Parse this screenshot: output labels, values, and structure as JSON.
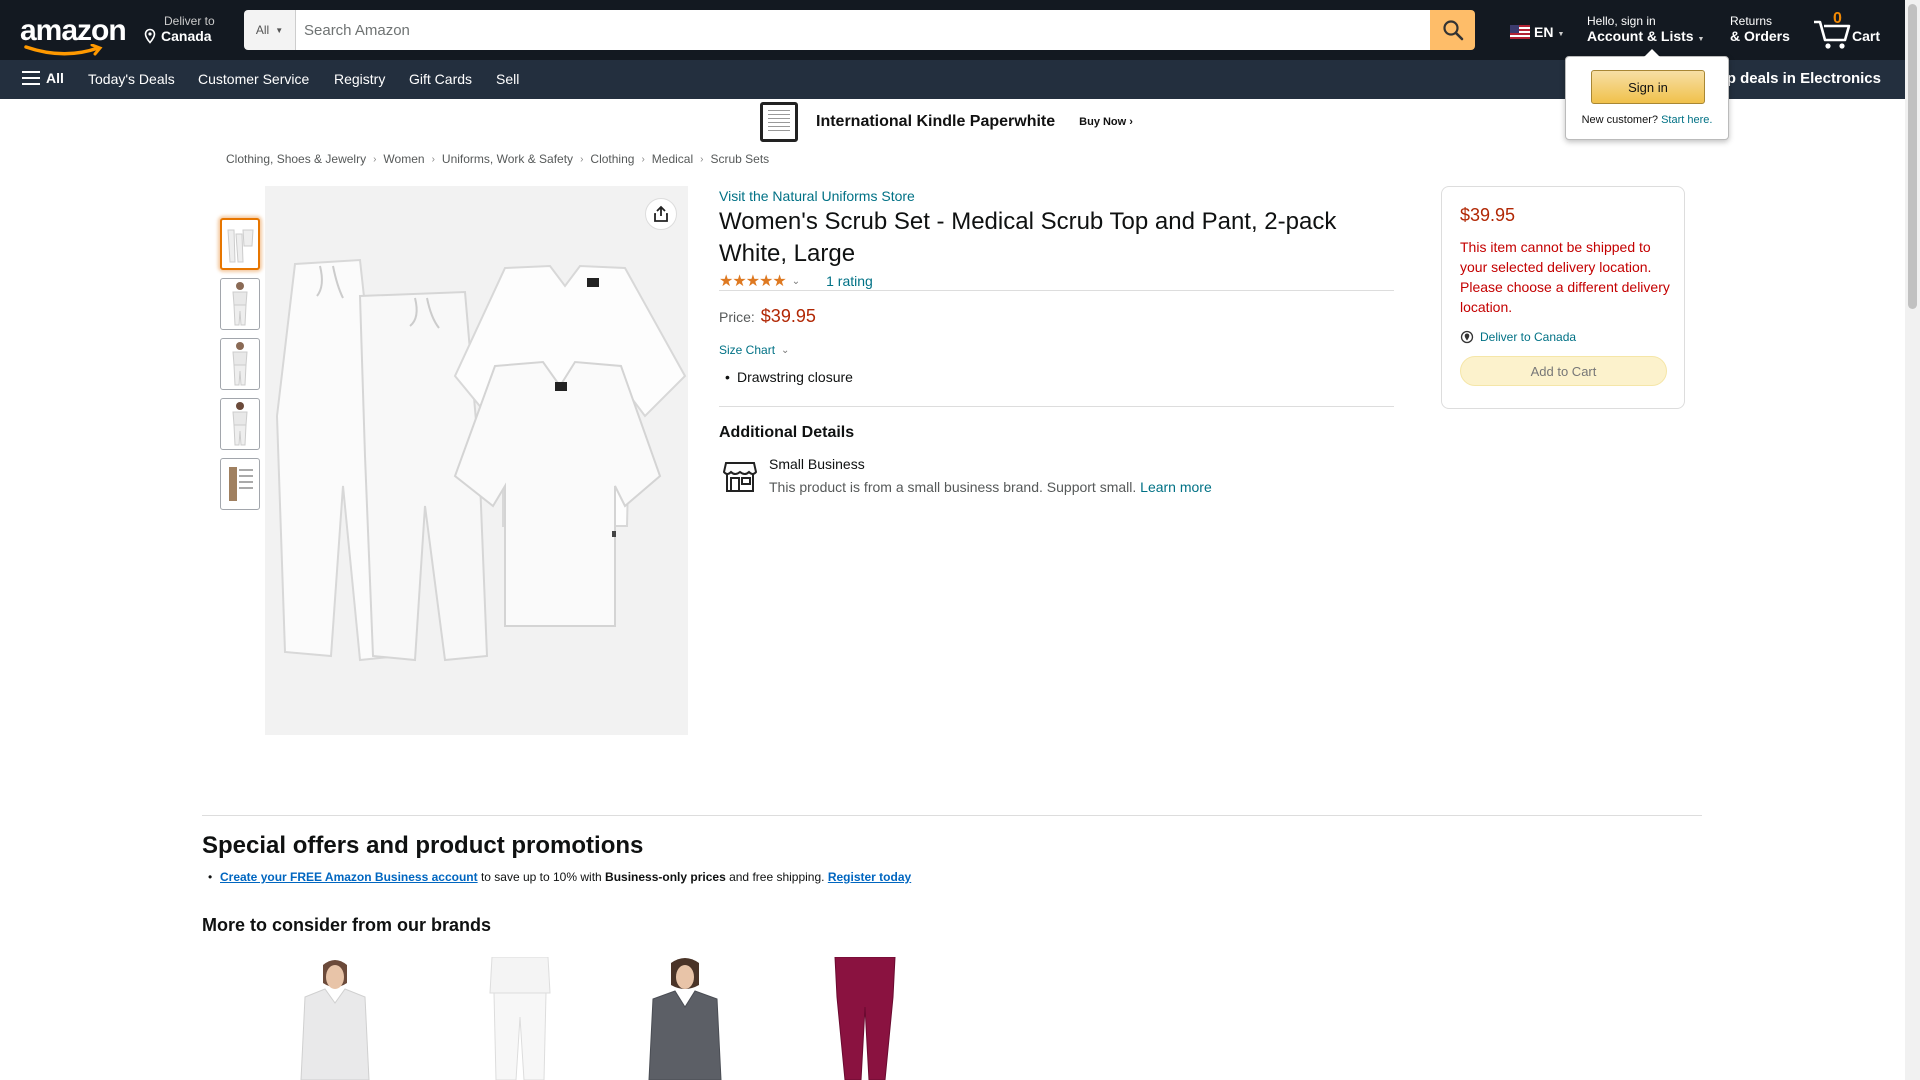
{
  "header": {
    "logo_text": "amazon",
    "deliver_line1": "Deliver to",
    "deliver_line2": "Canada",
    "search_category": "All",
    "search_placeholder": "Search Amazon",
    "language": "EN",
    "account_line1": "Hello, sign in",
    "account_line2": "Account & Lists",
    "returns_line1": "Returns",
    "returns_line2": "& Orders",
    "cart_count": "0",
    "cart_label": "Cart"
  },
  "subnav": {
    "all_label": "All",
    "items": [
      "Today's Deals",
      "Customer Service",
      "Registry",
      "Gift Cards",
      "Sell"
    ],
    "promo": "op deals in Electronics"
  },
  "banner": {
    "title": "International Kindle Paperwhite",
    "cta": "Buy Now ›"
  },
  "signin_popover": {
    "button": "Sign in",
    "new_customer": "New customer?",
    "start_here": "Start here."
  },
  "breadcrumb": [
    "Clothing, Shoes & Jewelry",
    "Women",
    "Uniforms, Work & Safety",
    "Clothing",
    "Medical",
    "Scrub Sets"
  ],
  "product": {
    "store_link": "Visit the Natural Uniforms Store",
    "title": "Women's Scrub Set - Medical Scrub Top and Pant, 2-pack White, Large",
    "rating_count": "1 rating",
    "stars": 5,
    "price_label": "Price:",
    "price": "$39.95",
    "size_chart": "Size Chart",
    "bullets": [
      "Drawstring closure"
    ],
    "additional_details_heading": "Additional Details",
    "small_business_title": "Small Business",
    "small_business_desc": "This product is from a small business brand. Support small.",
    "learn_more": "Learn more"
  },
  "buybox": {
    "price": "$39.95",
    "message": "This item cannot be shipped to your selected delivery location. Please choose a different delivery location.",
    "deliver_to": "Deliver to Canada",
    "add_to_cart": "Add to Cart"
  },
  "offers": {
    "heading": "Special offers and product promotions",
    "link1": "Create your FREE Amazon Business account",
    "text1": " to save up to 10% with ",
    "bold1": "Business-only prices",
    "text2": " and free shipping. ",
    "link2": "Register today"
  },
  "brands": {
    "heading": "More to consider from our brands"
  },
  "colors": {
    "nav_dark": "#131921",
    "nav_secondary": "#232f3e",
    "price_red": "#b12704",
    "link_teal": "#007185",
    "search_button": "#febd69",
    "star_orange": "#de7921"
  }
}
